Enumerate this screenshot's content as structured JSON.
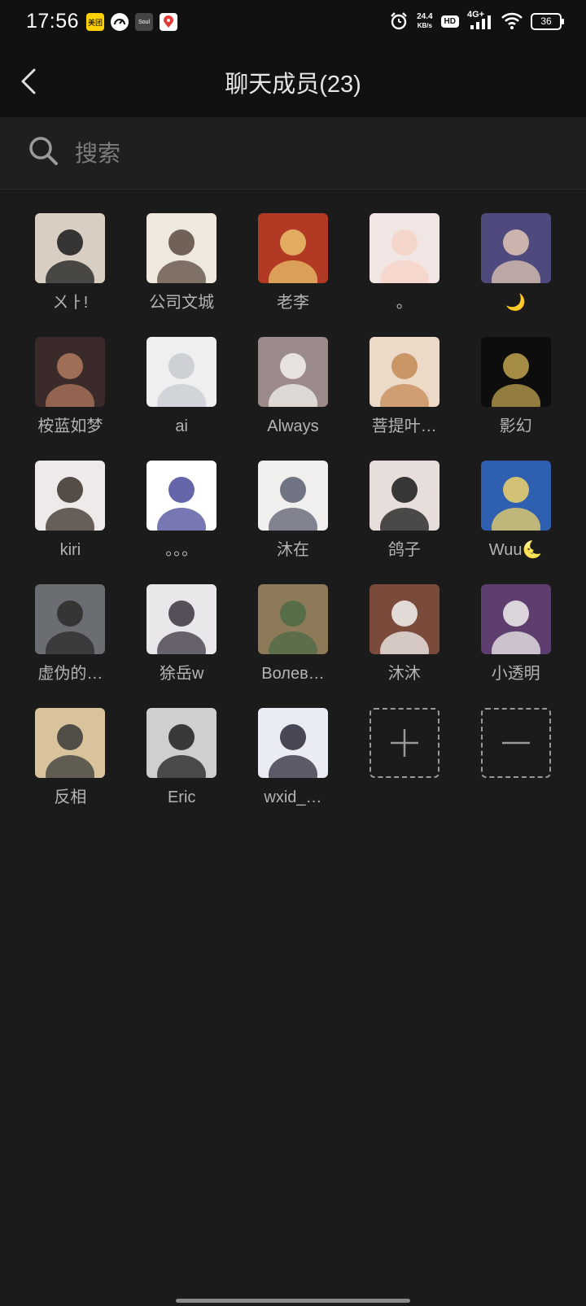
{
  "status_bar": {
    "time": "17:56",
    "apps": [
      {
        "name": "meituan",
        "label": "美团",
        "color": "#ffd100"
      },
      {
        "name": "speed-app",
        "label": "",
        "color": "#ffffff"
      },
      {
        "name": "soul",
        "label": "Soul",
        "color": "#3a3a3a"
      },
      {
        "name": "maps",
        "label": "",
        "color": "#ffffff"
      }
    ],
    "net_speed": "24.4",
    "net_unit": "KB/s",
    "hd": "HD",
    "network": "4G+",
    "battery": "36"
  },
  "header": {
    "title": "聊天成员(23)"
  },
  "search": {
    "placeholder": "搜索"
  },
  "members": [
    {
      "name": "ㄨㅏ!",
      "colors": [
        "#d8cfc2",
        "#1a1a1a"
      ],
      "icon": "person-hoodie"
    },
    {
      "name": "公司文城",
      "colors": [
        "#efe8dc",
        "#5a4a3f"
      ],
      "icon": "illustration"
    },
    {
      "name": "老李",
      "colors": [
        "#b23a24",
        "#e9c16b"
      ],
      "icon": "god-of-wealth"
    },
    {
      "name": "。",
      "colors": [
        "#f1e6e3",
        "#f6d2c7"
      ],
      "icon": "cat"
    },
    {
      "name": "🌙",
      "colors": [
        "#4e4a7d",
        "#e2c7b5"
      ],
      "icon": "fox"
    },
    {
      "name": "桉蓝如梦",
      "colors": [
        "#3a2b2a",
        "#b27a5e"
      ],
      "icon": "basketball-player"
    },
    {
      "name": "ai",
      "colors": [
        "#f0efef",
        "#c7cbd1"
      ],
      "icon": "anime-girl"
    },
    {
      "name": "Always",
      "colors": [
        "#9a8a8a",
        "#f4f1ec"
      ],
      "icon": "sheep-cartoon"
    },
    {
      "name": "菩提叶…",
      "colors": [
        "#ecd9c8",
        "#c68a55"
      ],
      "icon": "dog"
    },
    {
      "name": "影幻",
      "colors": [
        "#0d0d0d",
        "#bfa34f"
      ],
      "icon": "burst"
    },
    {
      "name": "kiri",
      "colors": [
        "#eeeaea",
        "#3a2f2a"
      ],
      "icon": "anime-girl-hood"
    },
    {
      "name": "。。。",
      "colors": [
        "#ffffff",
        "#4a4a9a"
      ],
      "icon": "doodle"
    },
    {
      "name": "沐在",
      "colors": [
        "#f1eeee",
        "#5b5e70"
      ],
      "icon": "anime-girl-long-hair"
    },
    {
      "name": "鸽子",
      "colors": [
        "#e7dedb",
        "#171717"
      ],
      "icon": "anime-girl-dark"
    },
    {
      "name": "Wuu🌜",
      "colors": [
        "#2f5fb0",
        "#f0d36b"
      ],
      "icon": "couple-shopping"
    },
    {
      "name": "虚伪的…",
      "colors": [
        "#6a6e72",
        "#2b2b2b"
      ],
      "icon": "seascape"
    },
    {
      "name": "狳岳w",
      "colors": [
        "#e9e7e9",
        "#3b3440"
      ],
      "icon": "anime-boy"
    },
    {
      "name": "Волев…",
      "colors": [
        "#8d7a59",
        "#4e6b45"
      ],
      "icon": "bookshelf-illustration"
    },
    {
      "name": "沐沐",
      "colors": [
        "#7a4a3a",
        "#f5f3f2"
      ],
      "icon": "white-dog"
    },
    {
      "name": "小透明",
      "colors": [
        "#5e3e6e",
        "#f1efef"
      ],
      "icon": "white-puppy"
    },
    {
      "name": "反相",
      "colors": [
        "#d8c39c",
        "#3a3a3a"
      ],
      "icon": "plush-phone"
    },
    {
      "name": "Eric",
      "colors": [
        "#cfcfcf",
        "#1e1e1e"
      ],
      "icon": "man-back"
    },
    {
      "name": "wxid_…",
      "colors": [
        "#e9ecf2",
        "#2a2a3a"
      ],
      "icon": "anime-panda-girl"
    }
  ],
  "actions": {
    "add_label": "add",
    "remove_label": "remove"
  }
}
